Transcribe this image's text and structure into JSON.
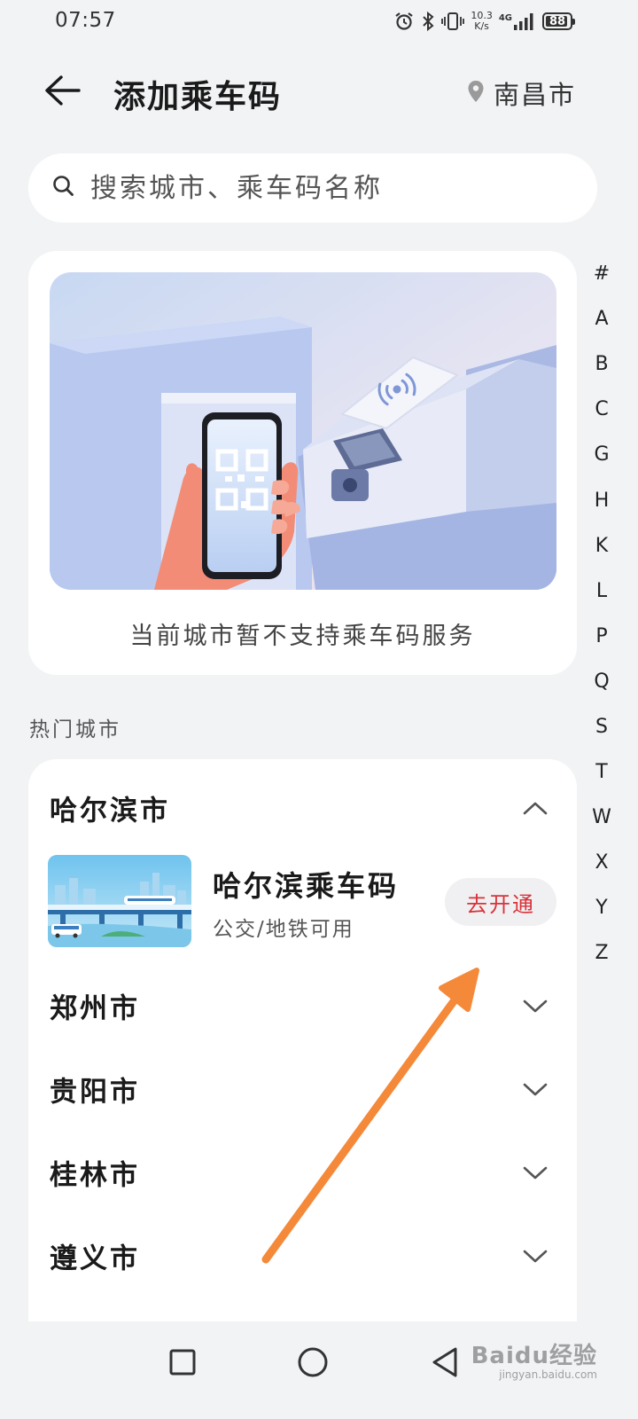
{
  "status_bar": {
    "time": "07:57",
    "net_speed_value": "10.3",
    "net_speed_unit": "K/s",
    "network_type": "4G",
    "battery": "88"
  },
  "header": {
    "title": "添加乘车码",
    "location": "南昌市"
  },
  "search": {
    "placeholder": "搜索城市、乘车码名称"
  },
  "banner": {
    "caption": "当前城市暂不支持乘车码服务"
  },
  "alphabet_index": [
    "#",
    "A",
    "B",
    "C",
    "G",
    "H",
    "K",
    "L",
    "P",
    "Q",
    "S",
    "T",
    "W",
    "X",
    "Y",
    "Z"
  ],
  "hot_cities": {
    "title": "热门城市",
    "cities": [
      {
        "name": "哈尔滨市",
        "expanded": true
      },
      {
        "name": "郑州市",
        "expanded": false
      },
      {
        "name": "贵阳市",
        "expanded": false
      },
      {
        "name": "桂林市",
        "expanded": false
      },
      {
        "name": "遵义市",
        "expanded": false
      }
    ],
    "expanded_item": {
      "name": "哈尔滨乘车码",
      "desc": "公交/地铁可用",
      "action": "去开通"
    }
  },
  "watermark": {
    "main": "Baidu经验",
    "sub": "jingyan.baidu.com"
  },
  "colors": {
    "background": "#f1f3f5",
    "card": "#ffffff",
    "accent_red": "#d9333a",
    "annotation_arrow": "#f5893a"
  },
  "icons": {
    "back": "arrow-left-icon",
    "location": "location-pin-icon",
    "search": "search-icon",
    "expand": "chevron-down-icon",
    "collapse": "chevron-up-icon"
  }
}
